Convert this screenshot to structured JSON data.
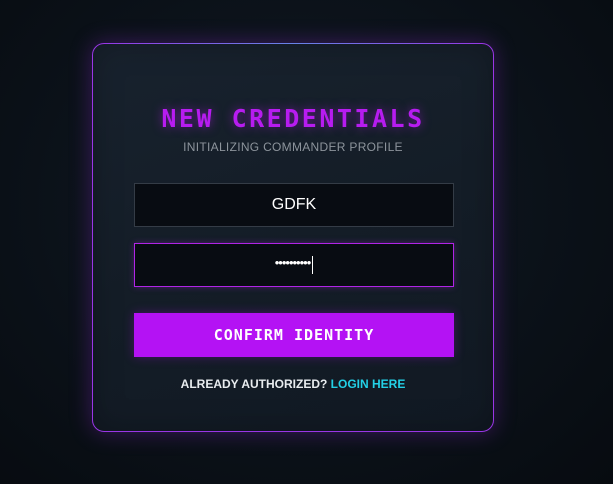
{
  "register": {
    "title": "NEW CREDENTIALS",
    "subtitle": "INITIALIZING COMMANDER PROFILE",
    "username_value": "GDFK",
    "password_masked": "••••••••••",
    "submit_label": "CONFIRM IDENTITY",
    "login_prompt": "ALREADY AUTHORIZED?",
    "login_link": "LOGIN HERE"
  },
  "colors": {
    "accent": "#b412f4",
    "link": "#23d0e6",
    "background": "#0c131b"
  }
}
